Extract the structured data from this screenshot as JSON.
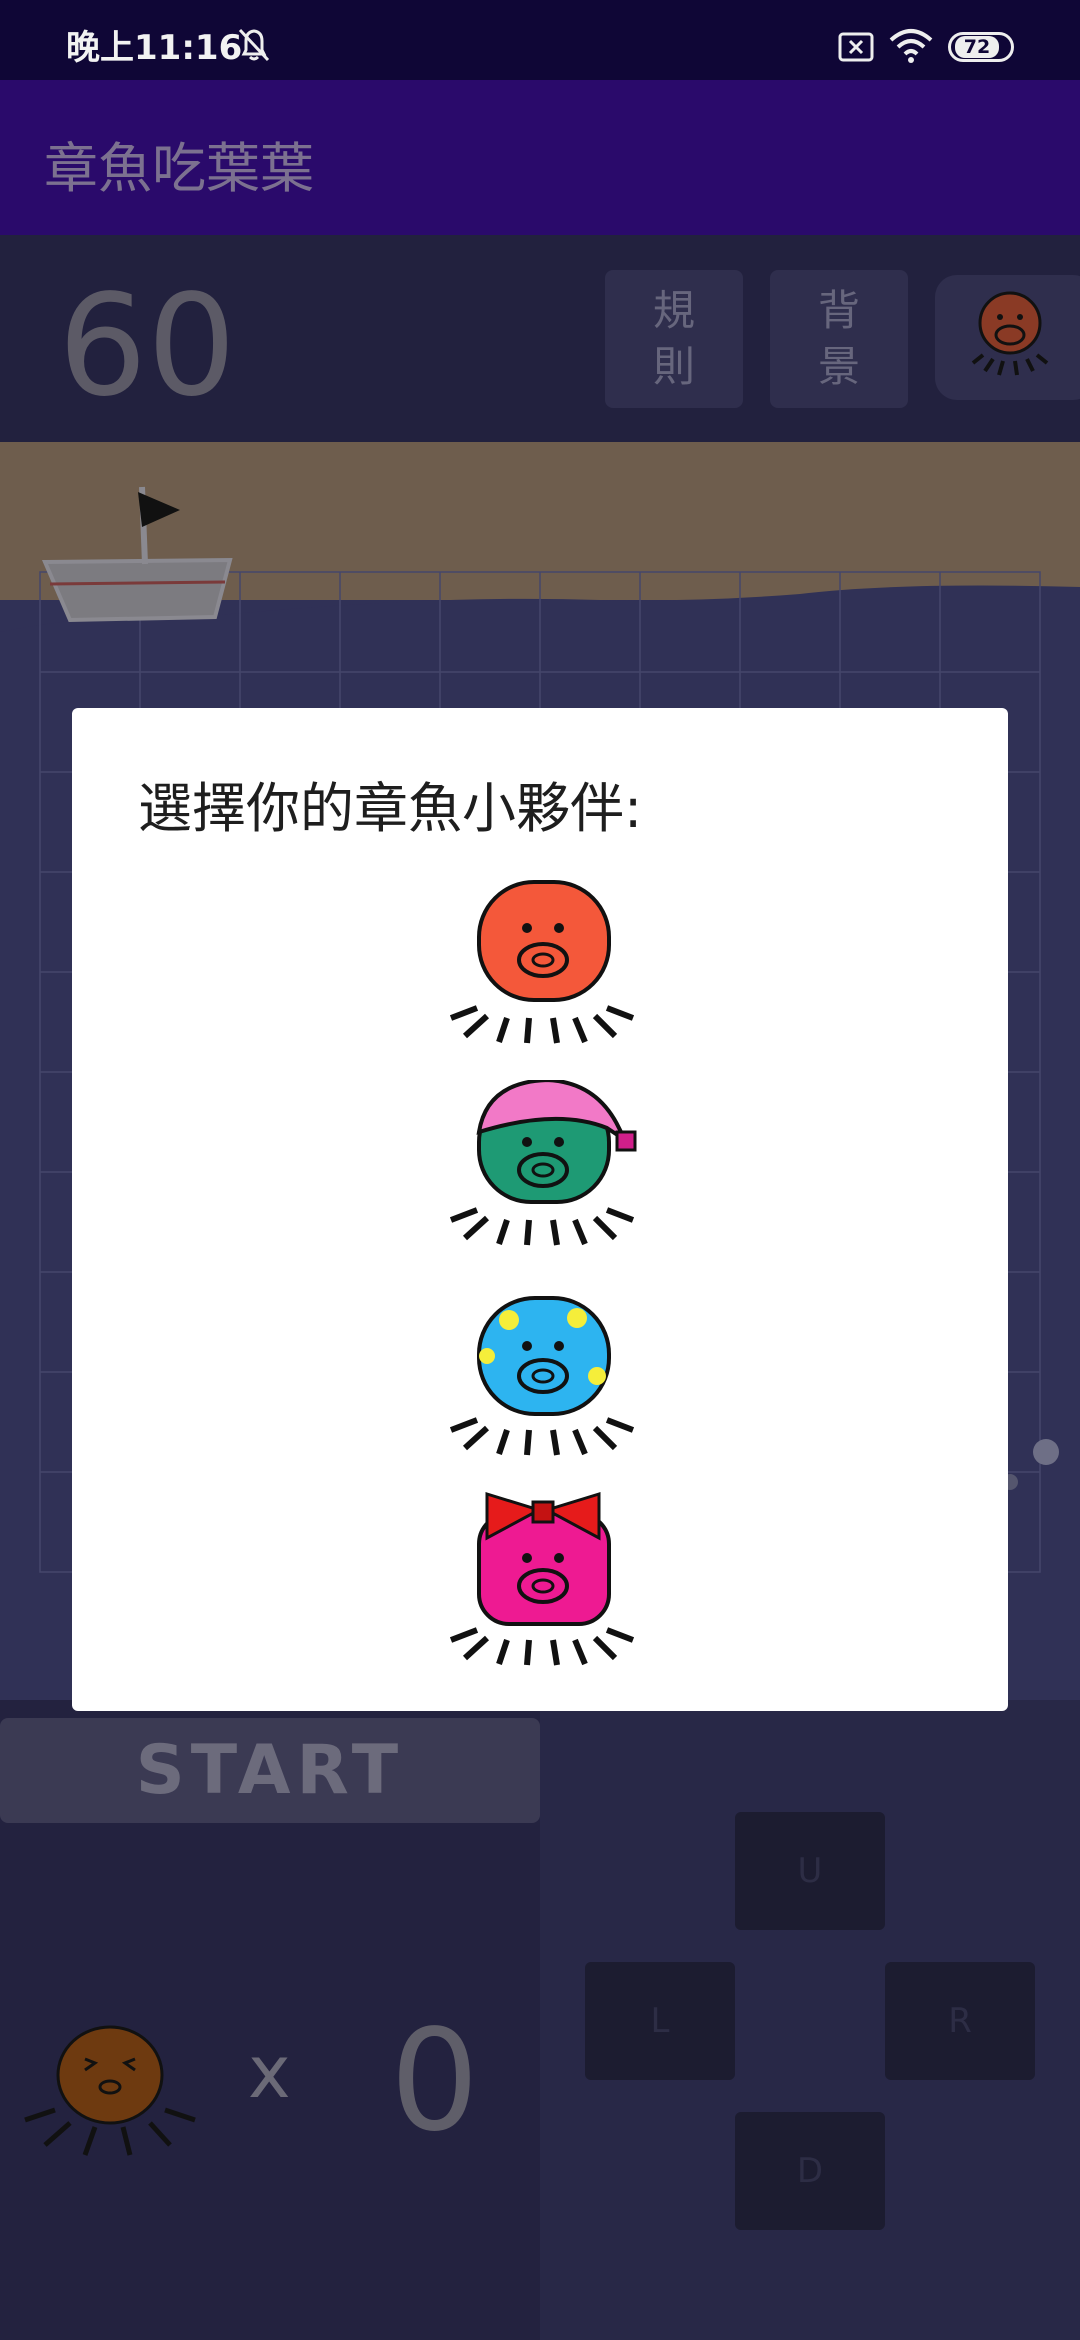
{
  "status_bar": {
    "time": "晚上11:16",
    "battery": "72",
    "icons": [
      "silent-bell-icon",
      "sim-none-icon",
      "wifi-icon",
      "battery-icon"
    ]
  },
  "app_bar": {
    "title": "章魚吃葉葉"
  },
  "top_panel": {
    "score": "60",
    "rules_label": "規則",
    "background_label": "背景"
  },
  "controls": {
    "start_label": "START",
    "up_label": "U",
    "left_label": "L",
    "right_label": "R",
    "down_label": "D"
  },
  "lives": {
    "times_label": "x",
    "count": "0"
  },
  "dialog": {
    "title": "選擇你的章魚小夥伴:",
    "options": [
      {
        "name": "orange-octopus",
        "color": "#f4583a"
      },
      {
        "name": "green-octopus-with-pink-nightcap",
        "color": "#1e9a74"
      },
      {
        "name": "blue-octopus-with-yellow-spots",
        "color": "#2db4f0"
      },
      {
        "name": "pink-octopus-with-red-bow",
        "color": "#ee1a92"
      }
    ]
  },
  "colors": {
    "status_bar_bg": "#0f0636",
    "app_bar_bg": "#2a0a6b",
    "sand": "#6e5d4d",
    "sea": "#303156"
  }
}
